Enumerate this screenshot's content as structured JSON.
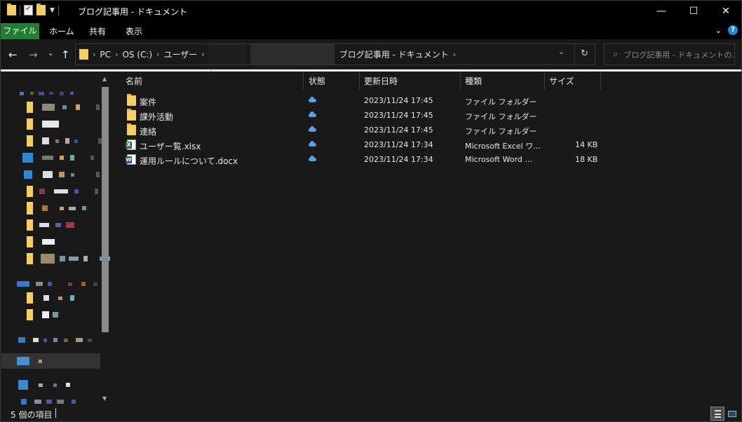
{
  "window": {
    "title": "ブログ記事用 - ドキュメント",
    "controls": {
      "minimize": "—",
      "maximize": "☐",
      "close": "✕"
    }
  },
  "ribbon": {
    "tabs": [
      "ファイル",
      "ホーム",
      "共有",
      "表示"
    ],
    "help": "?"
  },
  "address_bar": {
    "crumbs": [
      "PC",
      "OS (C:)",
      "ユーザー",
      "ブログ記事用 - ドキュメント"
    ],
    "separator": "›"
  },
  "search": {
    "placeholder": "ブログ記事用 - ドキュメントの..."
  },
  "columns": {
    "name": "名前",
    "status": "状態",
    "modified": "更新日時",
    "type": "種類",
    "size": "サイズ"
  },
  "files": [
    {
      "name": "案件",
      "icon": "folder-icon",
      "modified": "2023/11/24 17:45",
      "type": "ファイル フォルダー",
      "size": ""
    },
    {
      "name": "課外活動",
      "icon": "folder-icon",
      "modified": "2023/11/24 17:45",
      "type": "ファイル フォルダー",
      "size": ""
    },
    {
      "name": "連絡",
      "icon": "folder-icon",
      "modified": "2023/11/24 17:45",
      "type": "ファイル フォルダー",
      "size": ""
    },
    {
      "name": "ユーザー覧.xlsx",
      "icon": "excel-file-icon",
      "modified": "2023/11/24 17:34",
      "type": "Microsoft Excel ワ...",
      "size": "14 KB"
    },
    {
      "name": "運用ルールについて.docx",
      "icon": "word-file-icon",
      "modified": "2023/11/24 17:34",
      "type": "Microsoft Word ...",
      "size": "18 KB"
    }
  ],
  "status_bar": {
    "item_count": "5 個の項目"
  },
  "colors": {
    "background": "#191919",
    "title_bar": "#000000",
    "file_tab": "#1e7f2f",
    "folder": "#f6cf62",
    "cloud": "#5aa0e6"
  }
}
